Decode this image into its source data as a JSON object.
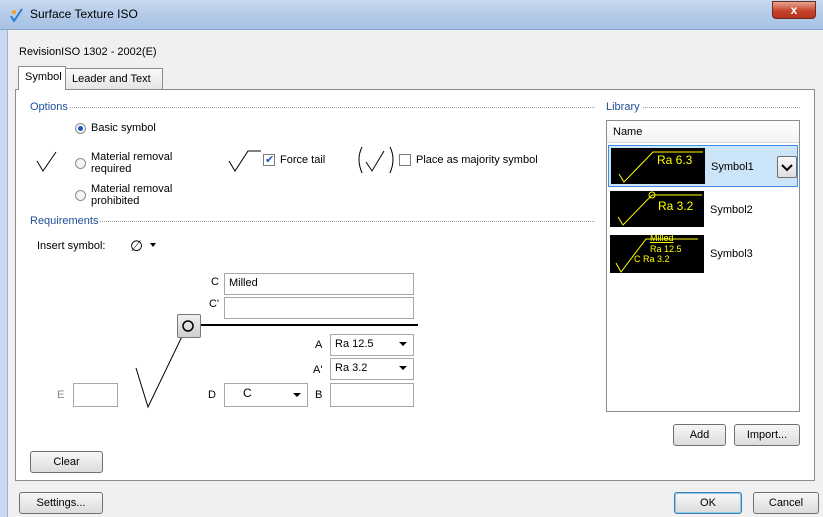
{
  "window": {
    "title": "Surface Texture ISO",
    "close_glyph": "x"
  },
  "revision": "RevisionISO 1302 - 2002(E)",
  "tabs": [
    {
      "label": "Symbol"
    },
    {
      "label": "Leader and Text"
    }
  ],
  "options": {
    "group_label": "Options",
    "basic_symbol": "Basic symbol",
    "material_removal_required": [
      "Material removal",
      "required"
    ],
    "material_removal_prohibited": [
      "Material removal",
      "prohibited"
    ],
    "force_tail": "Force tail",
    "place_as_majority": "Place as majority symbol"
  },
  "requirements": {
    "group_label": "Requirements",
    "insert_symbol_label": "Insert symbol:",
    "insert_symbol_value": "∅",
    "field_labels": {
      "C": "C",
      "C_prime": "C'",
      "A": "A",
      "A_prime": "A'",
      "D": "D",
      "B": "B",
      "E": "E"
    },
    "C_value": "Milled",
    "C_prime_value": "",
    "A_value": "Ra 12.5",
    "A_prime_value": "Ra 3.2",
    "D_value": "C",
    "B_value": "",
    "E_value": ""
  },
  "library": {
    "group_label": "Library",
    "column_header": "Name",
    "items": [
      {
        "name": "Symbol1",
        "thumb_lines": [
          "Ra 6.3"
        ],
        "selected": true
      },
      {
        "name": "Symbol2",
        "thumb_lines": [
          "Ra 3.2"
        ]
      },
      {
        "name": "Symbol3",
        "thumb_lines": [
          "Milled",
          "Ra 12.5",
          "C Ra 3.2"
        ]
      }
    ],
    "add_button": "Add",
    "import_button": "Import..."
  },
  "buttons": {
    "clear": "Clear",
    "settings": "Settings...",
    "ok": "OK",
    "cancel": "Cancel"
  },
  "colors": {
    "group_label": "#1f4e9a",
    "thumb_bg": "#000000",
    "thumb_fg": "#ffff00",
    "selection": "#3d8ee0"
  }
}
